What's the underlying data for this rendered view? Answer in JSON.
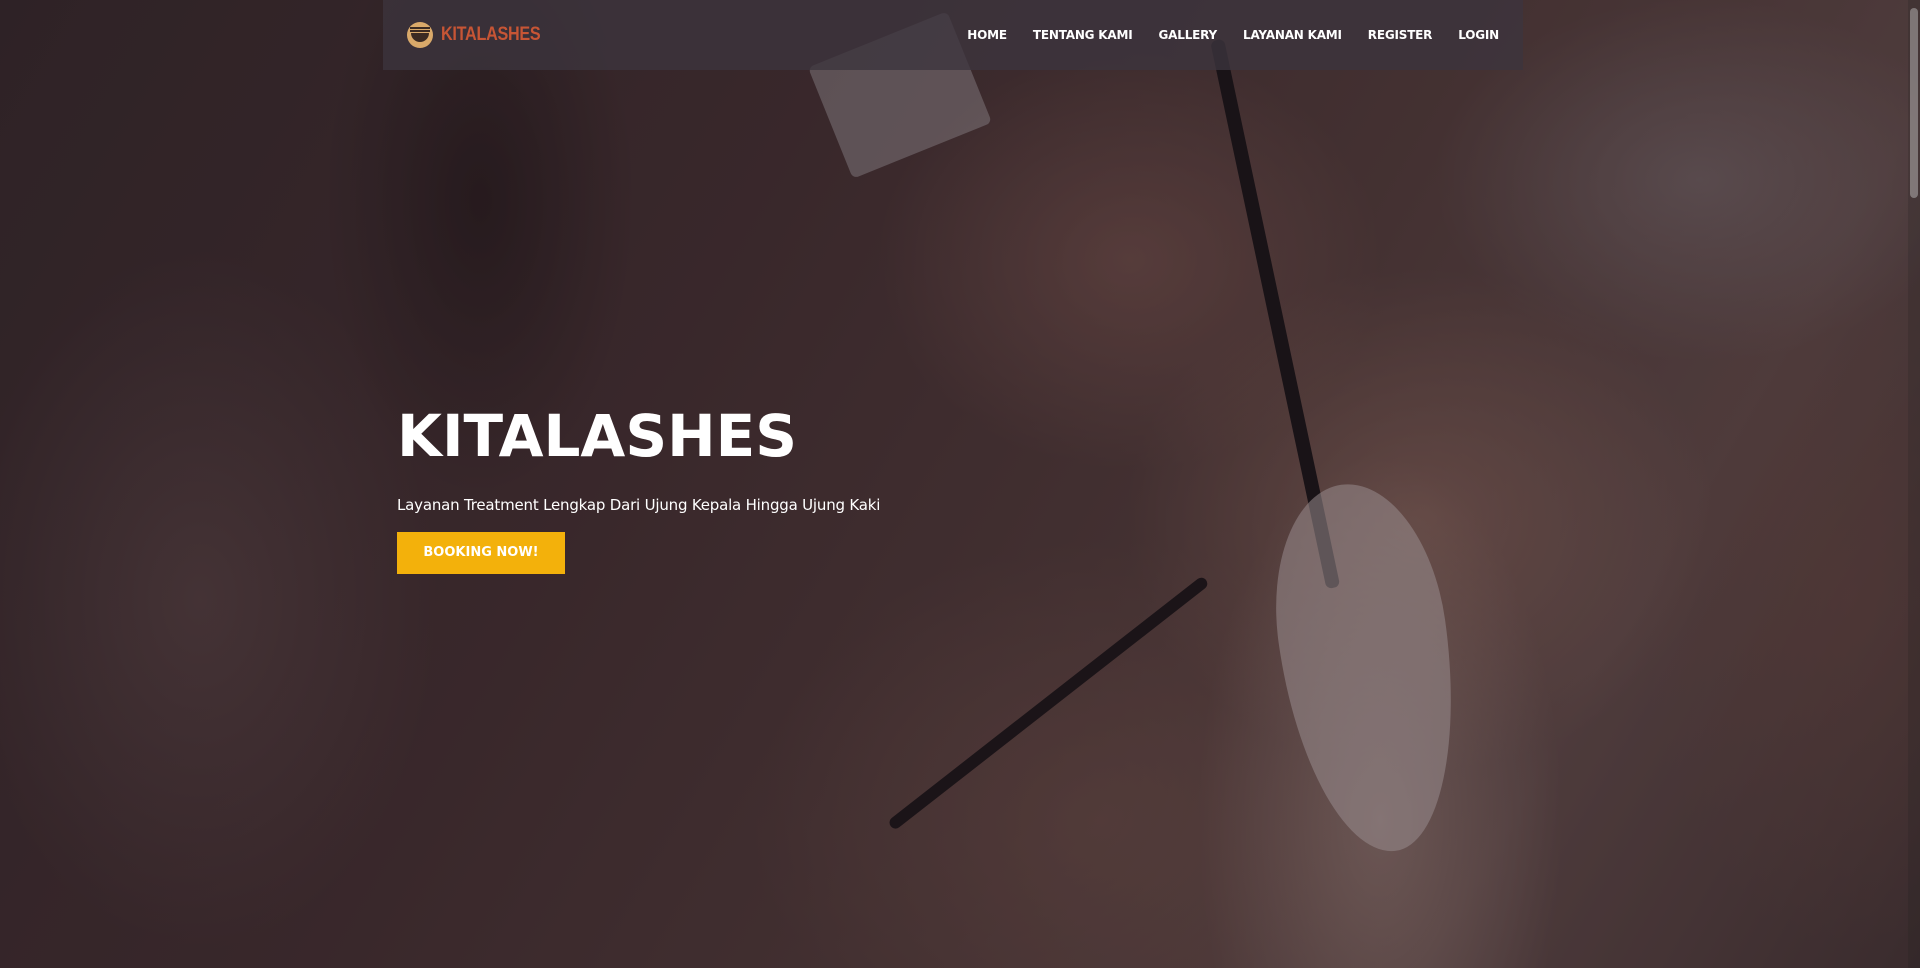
{
  "navbar": {
    "brand_name": "KITALASHES",
    "brand_logo_icon": "lash-eye-logo-icon",
    "items": [
      {
        "label": "HOME"
      },
      {
        "label": "TENTANG KAMI"
      },
      {
        "label": "GALLERY"
      },
      {
        "label": "LAYANAN KAMI"
      },
      {
        "label": "REGISTER"
      },
      {
        "label": "LOGIN"
      }
    ]
  },
  "hero": {
    "title": "KITALASHES",
    "subtitle": "Layanan Treatment Lengkap Dari Ujung Kepala Hingga Ujung Kaki",
    "cta_label": "BOOKING NOW!"
  },
  "colors": {
    "brand": "#c75535",
    "accent": "#f3b10b",
    "navbar_bg": "#3c343e"
  }
}
